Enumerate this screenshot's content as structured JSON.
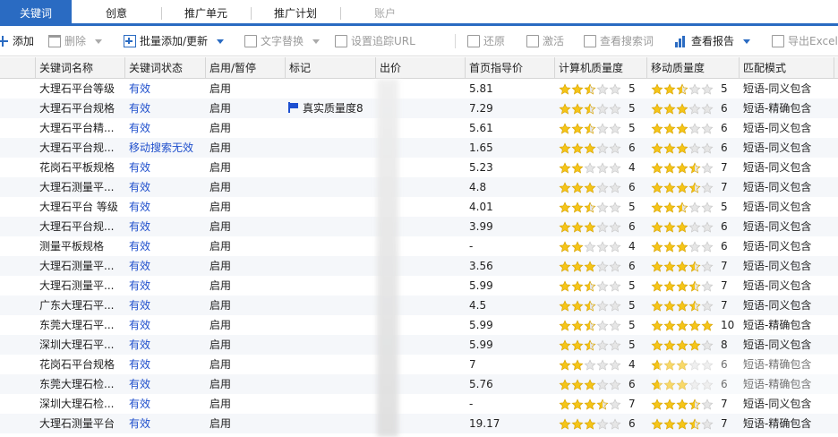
{
  "tabs": [
    {
      "label": "关键词",
      "active": true
    },
    {
      "label": "创意"
    },
    {
      "label": "推广单元"
    },
    {
      "label": "推广计划"
    },
    {
      "label": "账户",
      "disabled": true
    }
  ],
  "toolbar": {
    "add": "添加",
    "delete": "删除",
    "batch": "批量添加/更新",
    "replace": "文字替换",
    "tracking": "设置追踪URL",
    "restore": "还原",
    "activate": "激活",
    "view_search": "查看搜索词",
    "view_report": "查看报告",
    "export": "导出Excel"
  },
  "table": {
    "headers": [
      "关键词名称",
      "关键词状态",
      "启用/暂停",
      "标记",
      "出价",
      "首页指导价",
      "计算机质量度",
      "移动质量度",
      "匹配模式"
    ],
    "rows": [
      {
        "name": "大理石平台等级",
        "status": "有效",
        "enabled": "启用",
        "mark": "",
        "guide": "5.81",
        "pc_stars": 2.5,
        "pc": "5",
        "m_stars": 2.5,
        "m": "5",
        "match": "短语-同义包含"
      },
      {
        "name": "大理石平台规格",
        "status": "有效",
        "enabled": "启用",
        "mark": "真实质量度8",
        "guide": "7.29",
        "pc_stars": 2.5,
        "pc": "5",
        "m_stars": 3,
        "m": "6",
        "match": "短语-精确包含"
      },
      {
        "name": "大理石平台精...",
        "status": "有效",
        "enabled": "启用",
        "mark": "",
        "guide": "5.61",
        "pc_stars": 2.5,
        "pc": "5",
        "m_stars": 3,
        "m": "6",
        "match": "短语-同义包含"
      },
      {
        "name": "大理石平台规...",
        "status": "移动搜索无效",
        "enabled": "启用",
        "mark": "",
        "guide": "1.65",
        "pc_stars": 3,
        "pc": "6",
        "m_stars": 3,
        "m": "6",
        "match": "短语-同义包含"
      },
      {
        "name": "花岗石平板规格",
        "status": "有效",
        "enabled": "启用",
        "mark": "",
        "guide": "5.23",
        "pc_stars": 2,
        "pc": "4",
        "m_stars": 3.5,
        "m": "7",
        "match": "短语-同义包含"
      },
      {
        "name": "大理石测量平...",
        "status": "有效",
        "enabled": "启用",
        "mark": "",
        "guide": "4.8",
        "pc_stars": 3,
        "pc": "6",
        "m_stars": 3.5,
        "m": "7",
        "match": "短语-同义包含"
      },
      {
        "name": "大理石平台 等级",
        "status": "有效",
        "enabled": "启用",
        "mark": "",
        "guide": "4.01",
        "pc_stars": 2.5,
        "pc": "5",
        "m_stars": 2.5,
        "m": "5",
        "match": "短语-同义包含"
      },
      {
        "name": "大理石平台规...",
        "status": "有效",
        "enabled": "启用",
        "mark": "",
        "guide": "3.99",
        "pc_stars": 3,
        "pc": "6",
        "m_stars": 3,
        "m": "6",
        "match": "短语-同义包含"
      },
      {
        "name": "测量平板规格",
        "status": "有效",
        "enabled": "启用",
        "mark": "",
        "guide": "-",
        "pc_stars": 2,
        "pc": "4",
        "m_stars": 3,
        "m": "6",
        "match": "短语-同义包含"
      },
      {
        "name": "大理石测量平...",
        "status": "有效",
        "enabled": "启用",
        "mark": "",
        "guide": "3.56",
        "pc_stars": 3,
        "pc": "6",
        "m_stars": 3.5,
        "m": "7",
        "match": "短语-同义包含"
      },
      {
        "name": "大理石测量平...",
        "status": "有效",
        "enabled": "启用",
        "mark": "",
        "guide": "5.99",
        "pc_stars": 2.5,
        "pc": "5",
        "m_stars": 3.5,
        "m": "7",
        "match": "短语-同义包含"
      },
      {
        "name": "广东大理石平...",
        "status": "有效",
        "enabled": "启用",
        "mark": "",
        "guide": "4.5",
        "pc_stars": 2.5,
        "pc": "5",
        "m_stars": 3.5,
        "m": "7",
        "match": "短语-同义包含"
      },
      {
        "name": "东莞大理石平...",
        "status": "有效",
        "enabled": "启用",
        "mark": "",
        "guide": "5.99",
        "pc_stars": 2.5,
        "pc": "5",
        "m_stars": 5,
        "m": "10",
        "match": "短语-精确包含"
      },
      {
        "name": "深圳大理石平...",
        "status": "有效",
        "enabled": "启用",
        "mark": "",
        "guide": "5.99",
        "pc_stars": 2.5,
        "pc": "5",
        "m_stars": 4,
        "m": "8",
        "match": "短语-同义包含"
      },
      {
        "name": "花岗石平台规格",
        "status": "有效",
        "enabled": "启用",
        "mark": "",
        "guide": "7",
        "pc_stars": 2,
        "pc": "4",
        "m_stars": 3,
        "m": "6",
        "match": "短语-精确包含"
      },
      {
        "name": "东莞大理石检...",
        "status": "有效",
        "enabled": "启用",
        "mark": "",
        "guide": "5.76",
        "pc_stars": 3,
        "pc": "6",
        "m_stars": 3,
        "m": "6",
        "match": "短语-精确包含"
      },
      {
        "name": "深圳大理石检...",
        "status": "有效",
        "enabled": "启用",
        "mark": "",
        "guide": "-",
        "pc_stars": 3.5,
        "pc": "7",
        "m_stars": 3.5,
        "m": "7",
        "match": "短语-同义包含"
      },
      {
        "name": "大理石测量平台",
        "status": "有效",
        "enabled": "启用",
        "mark": "",
        "guide": "19.17",
        "pc_stars": 3,
        "pc": "6",
        "m_stars": 3.5,
        "m": "7",
        "match": "短语-精确包含"
      }
    ]
  },
  "colors": {
    "accent": "#2a6bc2",
    "star": "#f5c518",
    "status": "#1f4fcc"
  }
}
